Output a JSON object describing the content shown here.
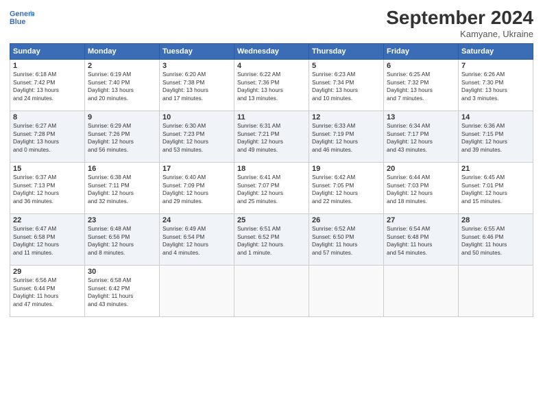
{
  "header": {
    "logo_line1": "General",
    "logo_line2": "Blue",
    "month": "September 2024",
    "location": "Kamyane, Ukraine"
  },
  "weekdays": [
    "Sunday",
    "Monday",
    "Tuesday",
    "Wednesday",
    "Thursday",
    "Friday",
    "Saturday"
  ],
  "weeks": [
    [
      {
        "day": "1",
        "info": "Sunrise: 6:18 AM\nSunset: 7:42 PM\nDaylight: 13 hours\nand 24 minutes."
      },
      {
        "day": "2",
        "info": "Sunrise: 6:19 AM\nSunset: 7:40 PM\nDaylight: 13 hours\nand 20 minutes."
      },
      {
        "day": "3",
        "info": "Sunrise: 6:20 AM\nSunset: 7:38 PM\nDaylight: 13 hours\nand 17 minutes."
      },
      {
        "day": "4",
        "info": "Sunrise: 6:22 AM\nSunset: 7:36 PM\nDaylight: 13 hours\nand 13 minutes."
      },
      {
        "day": "5",
        "info": "Sunrise: 6:23 AM\nSunset: 7:34 PM\nDaylight: 13 hours\nand 10 minutes."
      },
      {
        "day": "6",
        "info": "Sunrise: 6:25 AM\nSunset: 7:32 PM\nDaylight: 13 hours\nand 7 minutes."
      },
      {
        "day": "7",
        "info": "Sunrise: 6:26 AM\nSunset: 7:30 PM\nDaylight: 13 hours\nand 3 minutes."
      }
    ],
    [
      {
        "day": "8",
        "info": "Sunrise: 6:27 AM\nSunset: 7:28 PM\nDaylight: 13 hours\nand 0 minutes."
      },
      {
        "day": "9",
        "info": "Sunrise: 6:29 AM\nSunset: 7:26 PM\nDaylight: 12 hours\nand 56 minutes."
      },
      {
        "day": "10",
        "info": "Sunrise: 6:30 AM\nSunset: 7:23 PM\nDaylight: 12 hours\nand 53 minutes."
      },
      {
        "day": "11",
        "info": "Sunrise: 6:31 AM\nSunset: 7:21 PM\nDaylight: 12 hours\nand 49 minutes."
      },
      {
        "day": "12",
        "info": "Sunrise: 6:33 AM\nSunset: 7:19 PM\nDaylight: 12 hours\nand 46 minutes."
      },
      {
        "day": "13",
        "info": "Sunrise: 6:34 AM\nSunset: 7:17 PM\nDaylight: 12 hours\nand 43 minutes."
      },
      {
        "day": "14",
        "info": "Sunrise: 6:36 AM\nSunset: 7:15 PM\nDaylight: 12 hours\nand 39 minutes."
      }
    ],
    [
      {
        "day": "15",
        "info": "Sunrise: 6:37 AM\nSunset: 7:13 PM\nDaylight: 12 hours\nand 36 minutes."
      },
      {
        "day": "16",
        "info": "Sunrise: 6:38 AM\nSunset: 7:11 PM\nDaylight: 12 hours\nand 32 minutes."
      },
      {
        "day": "17",
        "info": "Sunrise: 6:40 AM\nSunset: 7:09 PM\nDaylight: 12 hours\nand 29 minutes."
      },
      {
        "day": "18",
        "info": "Sunrise: 6:41 AM\nSunset: 7:07 PM\nDaylight: 12 hours\nand 25 minutes."
      },
      {
        "day": "19",
        "info": "Sunrise: 6:42 AM\nSunset: 7:05 PM\nDaylight: 12 hours\nand 22 minutes."
      },
      {
        "day": "20",
        "info": "Sunrise: 6:44 AM\nSunset: 7:03 PM\nDaylight: 12 hours\nand 18 minutes."
      },
      {
        "day": "21",
        "info": "Sunrise: 6:45 AM\nSunset: 7:01 PM\nDaylight: 12 hours\nand 15 minutes."
      }
    ],
    [
      {
        "day": "22",
        "info": "Sunrise: 6:47 AM\nSunset: 6:58 PM\nDaylight: 12 hours\nand 11 minutes."
      },
      {
        "day": "23",
        "info": "Sunrise: 6:48 AM\nSunset: 6:56 PM\nDaylight: 12 hours\nand 8 minutes."
      },
      {
        "day": "24",
        "info": "Sunrise: 6:49 AM\nSunset: 6:54 PM\nDaylight: 12 hours\nand 4 minutes."
      },
      {
        "day": "25",
        "info": "Sunrise: 6:51 AM\nSunset: 6:52 PM\nDaylight: 12 hours\nand 1 minute."
      },
      {
        "day": "26",
        "info": "Sunrise: 6:52 AM\nSunset: 6:50 PM\nDaylight: 11 hours\nand 57 minutes."
      },
      {
        "day": "27",
        "info": "Sunrise: 6:54 AM\nSunset: 6:48 PM\nDaylight: 11 hours\nand 54 minutes."
      },
      {
        "day": "28",
        "info": "Sunrise: 6:55 AM\nSunset: 6:46 PM\nDaylight: 11 hours\nand 50 minutes."
      }
    ],
    [
      {
        "day": "29",
        "info": "Sunrise: 6:56 AM\nSunset: 6:44 PM\nDaylight: 11 hours\nand 47 minutes."
      },
      {
        "day": "30",
        "info": "Sunrise: 6:58 AM\nSunset: 6:42 PM\nDaylight: 11 hours\nand 43 minutes."
      },
      {
        "day": "",
        "info": ""
      },
      {
        "day": "",
        "info": ""
      },
      {
        "day": "",
        "info": ""
      },
      {
        "day": "",
        "info": ""
      },
      {
        "day": "",
        "info": ""
      }
    ]
  ]
}
